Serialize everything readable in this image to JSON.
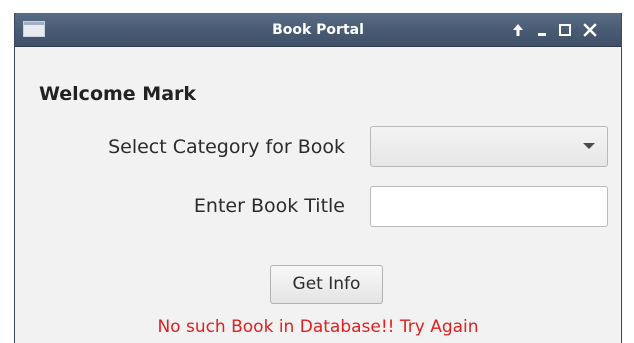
{
  "window": {
    "title": "Book Portal",
    "controls": {
      "up": "up-arrow-icon",
      "minimize": "minimize-icon",
      "maximize": "maximize-icon",
      "close": "close-icon"
    }
  },
  "form": {
    "welcome": "Welcome Mark",
    "category_label": "Select Category for Book",
    "category_value": "",
    "title_label": "Enter Book Title",
    "title_value": "",
    "title_placeholder": "",
    "submit_label": "Get Info",
    "error_message": "No such Book in Database!! Try Again"
  },
  "colors": {
    "titlebar": "#4a5c74",
    "error": "#e02020",
    "background": "#f2f2f2"
  }
}
